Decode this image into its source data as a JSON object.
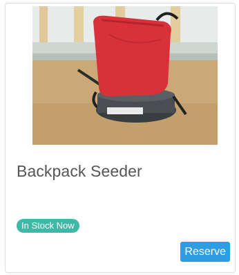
{
  "product": {
    "title": "Backpack Seeder",
    "image_alt": "Backpack Seeder",
    "stock_badge": "In Stock Now",
    "reserve_label": "Reserve"
  },
  "colors": {
    "badge": "#3fb8a6",
    "button": "#2f9ee0",
    "bag_red": "#d9313a",
    "title_text": "#555555"
  }
}
